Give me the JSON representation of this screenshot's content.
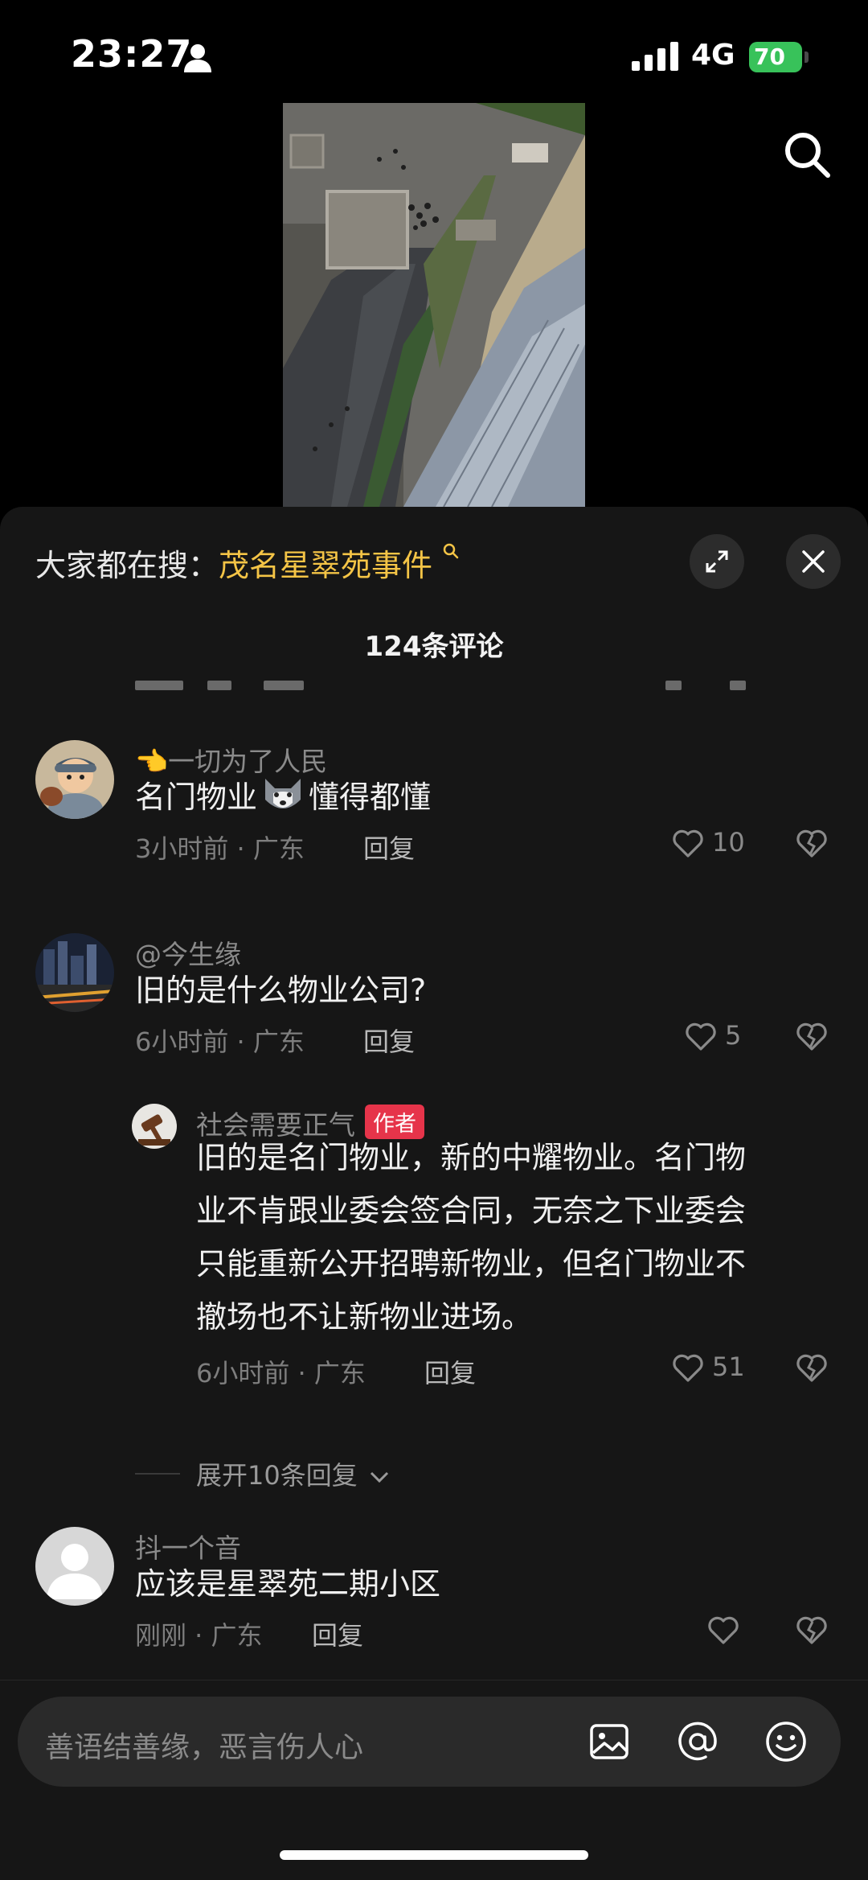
{
  "status_bar": {
    "time": "23:27",
    "network": "4G",
    "battery": "70"
  },
  "header": {
    "hot_search_label": "大家都在搜：",
    "hot_search_keyword": "茂名星翠苑事件",
    "comment_count": "124条评论"
  },
  "comments": [
    {
      "username": "👈一切为了人民",
      "text_before": "名门物业",
      "text_after": "懂得都懂",
      "time": "3小时前 · 广东",
      "reply": "回复",
      "likes": "10"
    },
    {
      "username": "@今生缘",
      "text": "旧的是什么物业公司?",
      "time": "6小时前 · 广东",
      "reply": "回复",
      "likes": "5"
    },
    {
      "username": "社会需要正气",
      "badge": "作者",
      "text_lines": [
        "旧的是名门物业，新的中耀物业。名门物",
        "业不肯跟业委会签合同，无奈之下业委会",
        "只能重新公开招聘新物业，但名门物业不",
        "撤场也不让新物业进场。"
      ],
      "time": "6小时前 · 广东",
      "reply": "回复",
      "likes": "51"
    },
    {
      "username": "抖一个音",
      "text": "应该是星翠苑二期小区",
      "time": "刚刚 · 广东",
      "reply": "回复",
      "likes": ""
    }
  ],
  "expand_replies": "展开10条回复",
  "input": {
    "placeholder": "善语结善缘，恶言伤人心"
  },
  "icons": [
    "person-icon",
    "signal-icon",
    "search-icon",
    "expand-icon",
    "close-icon",
    "heart-icon",
    "dislike-heart-icon",
    "image-icon",
    "at-icon",
    "emoji-icon"
  ],
  "colors": {
    "keyword": "#f4c446",
    "author_badge": "#e6344a",
    "battery": "#38c25a"
  }
}
